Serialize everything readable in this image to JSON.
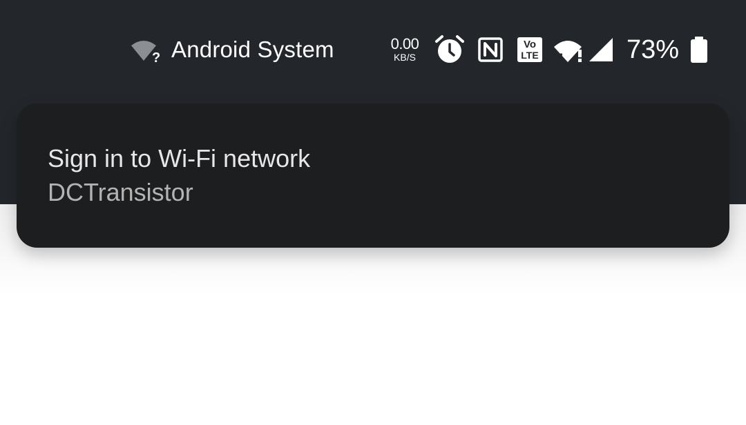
{
  "status_bar": {
    "app_name": "Android System",
    "app_icon": "wifi-question-icon",
    "net_speed_value": "0.00",
    "net_speed_unit": "KB/S",
    "icons": [
      "alarm-icon",
      "nfc-icon",
      "volte-icon",
      "wifi-alert-icon",
      "cell-signal-icon",
      "battery-icon"
    ],
    "volte_top": "Vo",
    "volte_bottom": "LTE",
    "battery_percent": "73%"
  },
  "notification": {
    "title": "Sign in to Wi-Fi network",
    "text": "DCTransistor"
  },
  "colors": {
    "header_bg": "#23272c",
    "card_bg": "#1d1e20",
    "title_text": "#e7e7e7",
    "secondary_text": "#b4b4b4",
    "page_bg": "#ffffff"
  }
}
